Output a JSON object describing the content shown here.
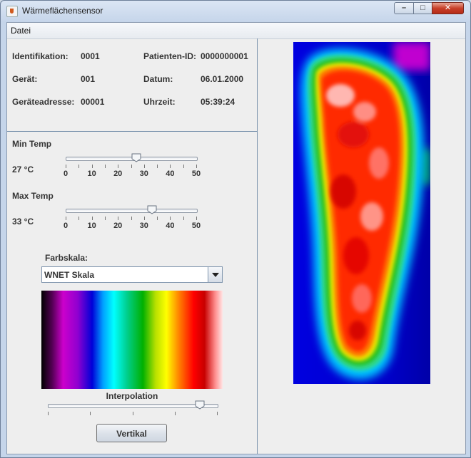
{
  "window": {
    "title": "Wärmeflächensensor",
    "controls": {
      "minimize": "–",
      "maximize": "□",
      "close": "✕"
    }
  },
  "menubar": {
    "items": [
      "Datei"
    ]
  },
  "info": {
    "identifikation": {
      "label": "Identifikation:",
      "value": "0001"
    },
    "patienten_id": {
      "label": "Patienten-ID:",
      "value": "0000000001"
    },
    "geraet": {
      "label": "Gerät:",
      "value": "001"
    },
    "datum": {
      "label": "Datum:",
      "value": "06.01.2000"
    },
    "geraeteadresse": {
      "label": "Geräteadresse:",
      "value": "00001"
    },
    "uhrzeit": {
      "label": "Uhrzeit:",
      "value": "05:39:24"
    }
  },
  "min_temp": {
    "label": "Min Temp",
    "value_text": "27 °C",
    "value": 27,
    "min": 0,
    "max": 50,
    "tick_labels": [
      "0",
      "10",
      "20",
      "30",
      "40",
      "50"
    ]
  },
  "max_temp": {
    "label": "Max Temp",
    "value_text": "33 °C",
    "value": 33,
    "min": 0,
    "max": 50,
    "tick_labels": [
      "0",
      "10",
      "20",
      "30",
      "40",
      "50"
    ]
  },
  "farbskala": {
    "label": "Farbskala:",
    "selected": "WNET Skala"
  },
  "interpolation": {
    "label": "Interpolation",
    "value_fraction": 0.9
  },
  "orientation_button": {
    "label": "Vertikal"
  },
  "colors": {
    "window_bg": "#eeeeee",
    "border": "#7b93ad",
    "heatmap_background": "#0000d8"
  }
}
